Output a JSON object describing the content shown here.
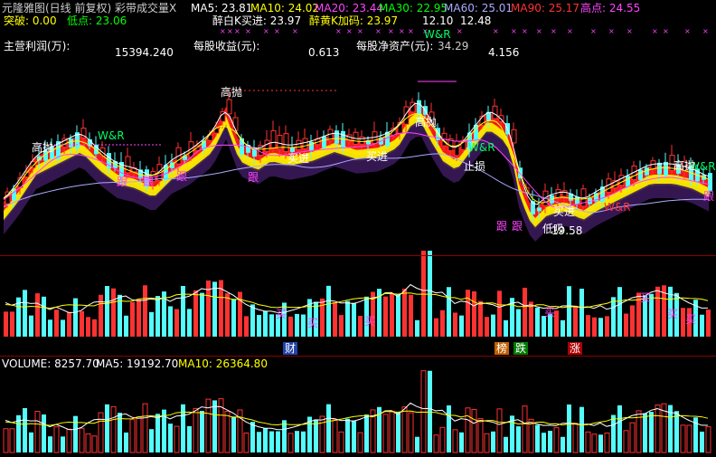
{
  "header": {
    "title": "元隆雅图(日线 前复权) 彩带成交量X",
    "ma": [
      {
        "label": "MA5: 23.81",
        "color": "#ffffff"
      },
      {
        "label": "MA10: 24.02",
        "color": "#ffff00"
      },
      {
        "label": "MA20: 23.44",
        "color": "#ff44ff"
      },
      {
        "label": "MA30: 22.95",
        "color": "#00ff00"
      },
      {
        "label": "MA60: 25.01",
        "color": "#aaaaff"
      },
      {
        "label": "MA90: 25.17",
        "color": "#ff3333"
      }
    ],
    "high": "高点: 24.55",
    "breakout": "突破: 0.00",
    "low": "低点: 23.06",
    "zuibai": "醉白K买进: 23.97",
    "zuihuang": "醉黄K加码: 23.97",
    "v1": "12.10",
    "v2": "12.48"
  },
  "fundamentals": {
    "profit_label": "主营利润(万):",
    "profit_value": "15394.240",
    "eps_label": "每股收益(元):",
    "eps_value": "0.613",
    "nav_label": "每股净资产(元):",
    "nav_value": "4.156",
    "price_overlay": "34.29"
  },
  "annotations": {
    "wr": "W&R",
    "buy": "买进",
    "follow": "跟",
    "high_label": "高抛",
    "low_label": "低吸",
    "stop": "止损",
    "low_value": "19.58",
    "buy_short": "买",
    "cai": "财",
    "bang": "榜",
    "die": "跌",
    "zhang": "涨"
  },
  "volume": {
    "label": "VOLUME: 8257.70",
    "ma5": "MA5: 19192.70",
    "ma10": "MA10: 26364.80"
  },
  "colors": {
    "up": "#ff3232",
    "down": "#54fcfc",
    "ma5": "#ffffff",
    "ma10": "#ffff00",
    "ma20": "#ff44ff",
    "ma60": "#aaaaff"
  }
}
